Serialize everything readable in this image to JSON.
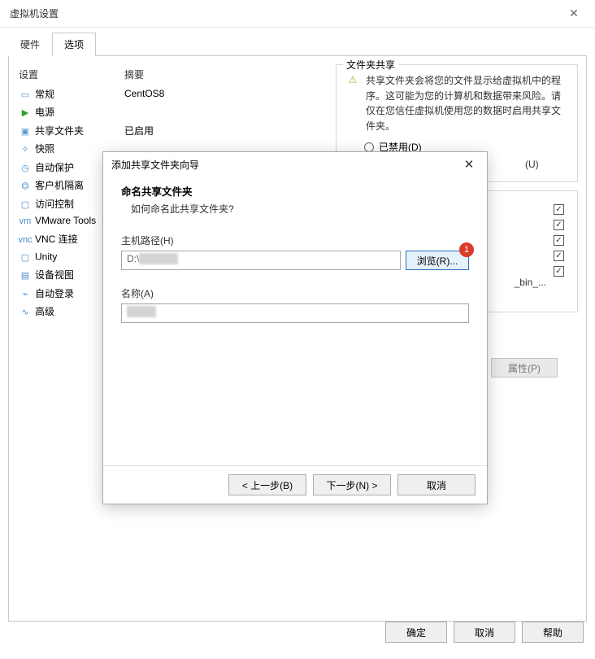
{
  "window": {
    "title": "虚拟机设置",
    "close": "✕"
  },
  "tabs": {
    "hardware": "硬件",
    "options": "选项"
  },
  "table": {
    "head_setting": "设置",
    "head_summary": "摘要",
    "rows": [
      {
        "icon": "monitor",
        "label": "常规",
        "summary": "CentOS8"
      },
      {
        "icon": "power",
        "label": "电源",
        "summary": ""
      },
      {
        "icon": "folder",
        "label": "共享文件夹",
        "summary": "已启用",
        "selected": false
      },
      {
        "icon": "camera",
        "label": "快照",
        "summary": ""
      },
      {
        "icon": "clock",
        "label": "自动保护",
        "summary": ""
      },
      {
        "icon": "lock",
        "label": "客户机隔离",
        "summary": ""
      },
      {
        "icon": "shield",
        "label": "访问控制",
        "summary": ""
      },
      {
        "icon": "tools",
        "label": "VMware Tools",
        "summary": ""
      },
      {
        "icon": "vnc",
        "label": "VNC 连接",
        "summary": ""
      },
      {
        "icon": "unity",
        "label": "Unity",
        "summary": ""
      },
      {
        "icon": "device",
        "label": "设备视图",
        "summary": ""
      },
      {
        "icon": "key",
        "label": "自动登录",
        "summary": ""
      },
      {
        "icon": "adv",
        "label": "高级",
        "summary": ""
      }
    ]
  },
  "share": {
    "legend": "文件夹共享",
    "warn": "共享文件夹会将您的文件显示给虚拟机中的程序。这可能为您的计算机和数据带来风险。请仅在您信任虚拟机使用您的数据时启用共享文件夹。",
    "radio_disabled": "已禁用(D)",
    "partial_suffix": "(U)",
    "bin_label": "_bin_...",
    "prop_btn": "属性(P)"
  },
  "wizard": {
    "title": "添加共享文件夹向导",
    "close": "✕",
    "h1": "命名共享文件夹",
    "h2": "如何命名此共享文件夹?",
    "host_path_label": "主机路径(H)",
    "host_path_value": "D:\\",
    "browse": "浏览(R)...",
    "badge": "1",
    "name_label": "名称(A)",
    "name_value": "",
    "back": "< 上一步(B)",
    "next": "下一步(N) >",
    "cancel": "取消"
  },
  "footer": {
    "ok": "确定",
    "cancel": "取消",
    "help": "帮助"
  },
  "icons": {
    "monitor": "▭",
    "power": "▶",
    "folder": "▣",
    "camera": "✧",
    "clock": "◷",
    "lock": "⏣",
    "shield": "▢",
    "tools": "vm",
    "vnc": "vnc",
    "unity": "▢",
    "device": "▤",
    "key": "⌁",
    "adv": "∿",
    "warn": "⚠"
  }
}
